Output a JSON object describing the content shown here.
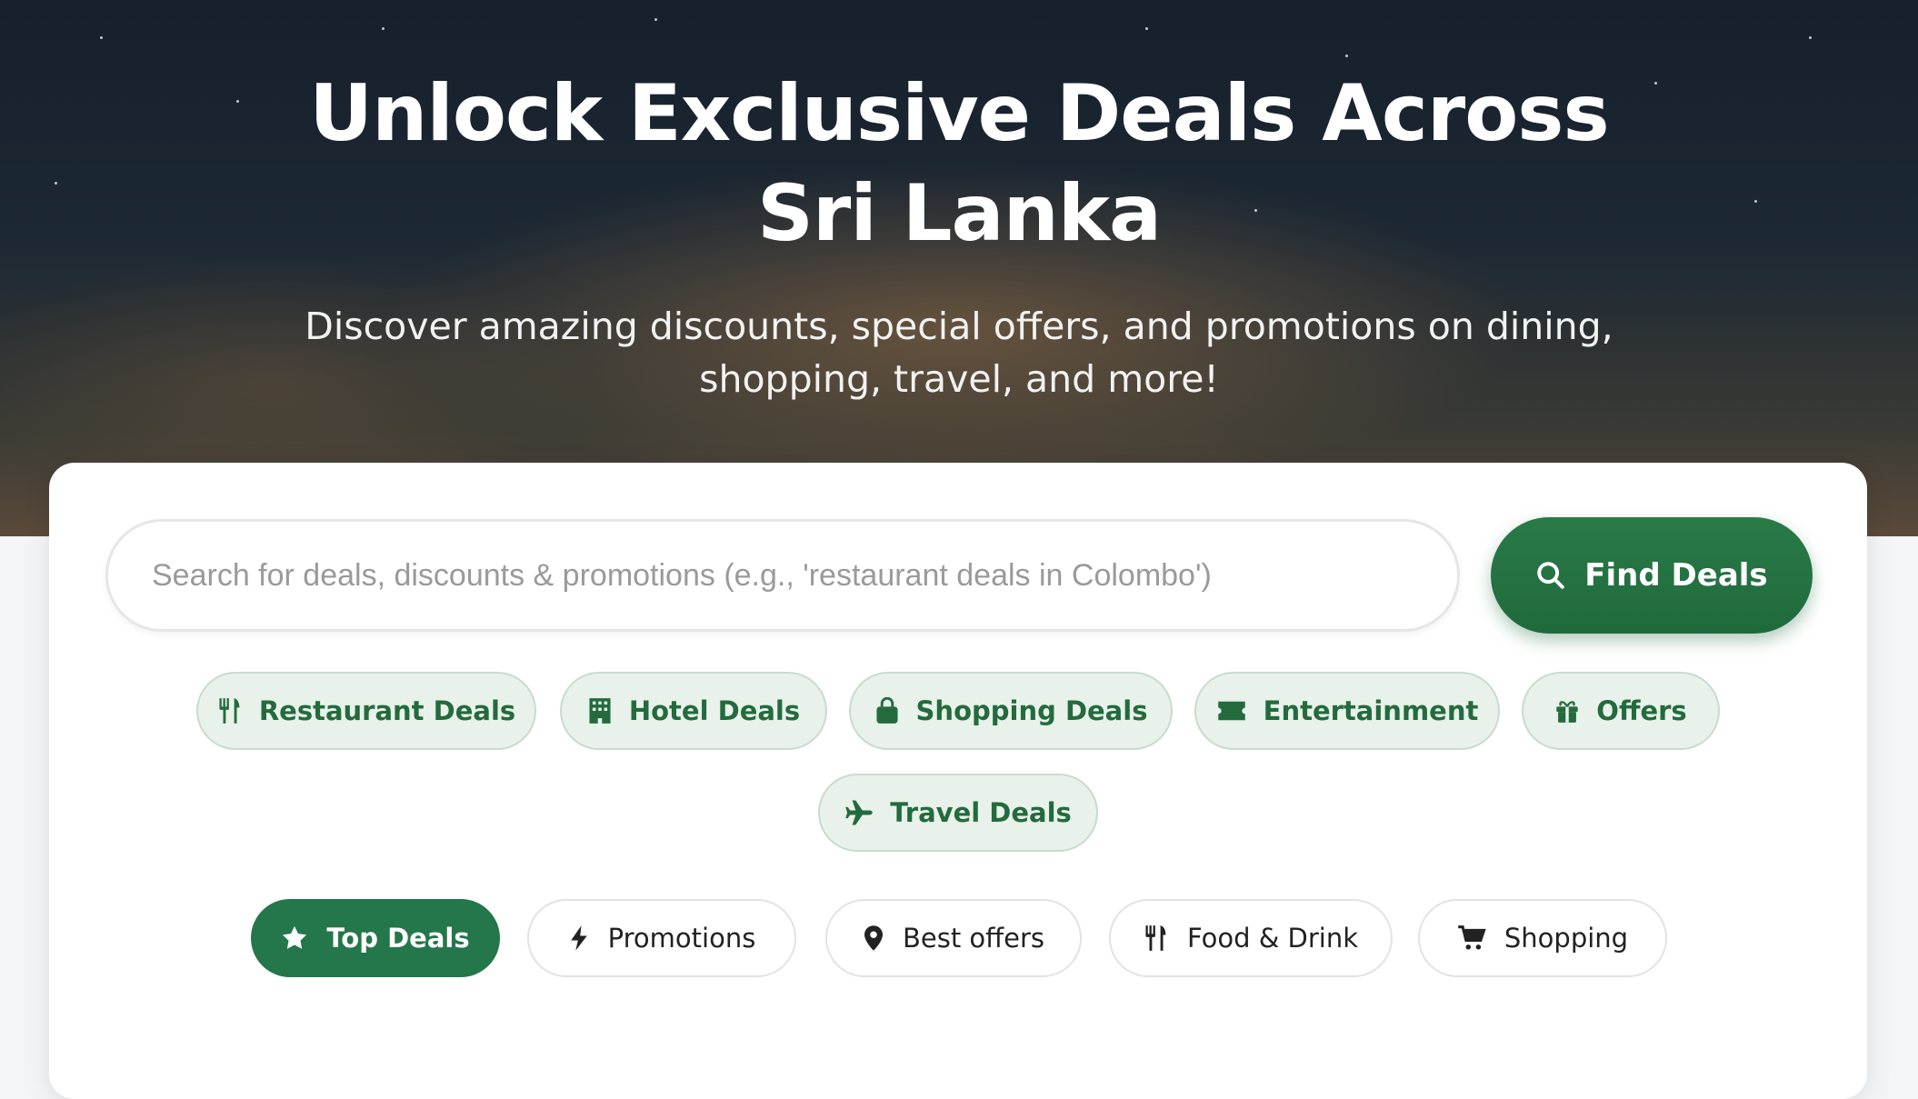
{
  "hero": {
    "title_line1": "Unlock Exclusive Deals Across",
    "title_line2": "Sri Lanka",
    "subtitle_line1": "Discover amazing discounts, special offers, and promotions on dining,",
    "subtitle_line2": "shopping, travel, and more!"
  },
  "search": {
    "placeholder": "Search for deals, discounts & promotions (e.g., 'restaurant deals in Colombo')",
    "value": "",
    "button_label": "Find Deals",
    "button_icon": "search-icon"
  },
  "categories": [
    {
      "label": "Restaurant Deals",
      "icon": "utensils-icon"
    },
    {
      "label": "Hotel Deals",
      "icon": "hotel-icon"
    },
    {
      "label": "Shopping Deals",
      "icon": "shopping-bag-icon"
    },
    {
      "label": "Entertainment",
      "icon": "ticket-icon"
    },
    {
      "label": "Offers",
      "icon": "gift-icon"
    },
    {
      "label": "Travel Deals",
      "icon": "plane-icon"
    }
  ],
  "tabs": [
    {
      "label": "Top Deals",
      "icon": "star-icon",
      "active": true
    },
    {
      "label": "Promotions",
      "icon": "bolt-icon",
      "active": false
    },
    {
      "label": "Best offers",
      "icon": "map-pin-icon",
      "active": false
    },
    {
      "label": "Food & Drink",
      "icon": "utensils-icon",
      "active": false
    },
    {
      "label": "Shopping",
      "icon": "cart-icon",
      "active": false
    }
  ],
  "colors": {
    "accent": "#24774a",
    "pill_background": "#e8f1ea",
    "pill_text": "#236b3d"
  }
}
